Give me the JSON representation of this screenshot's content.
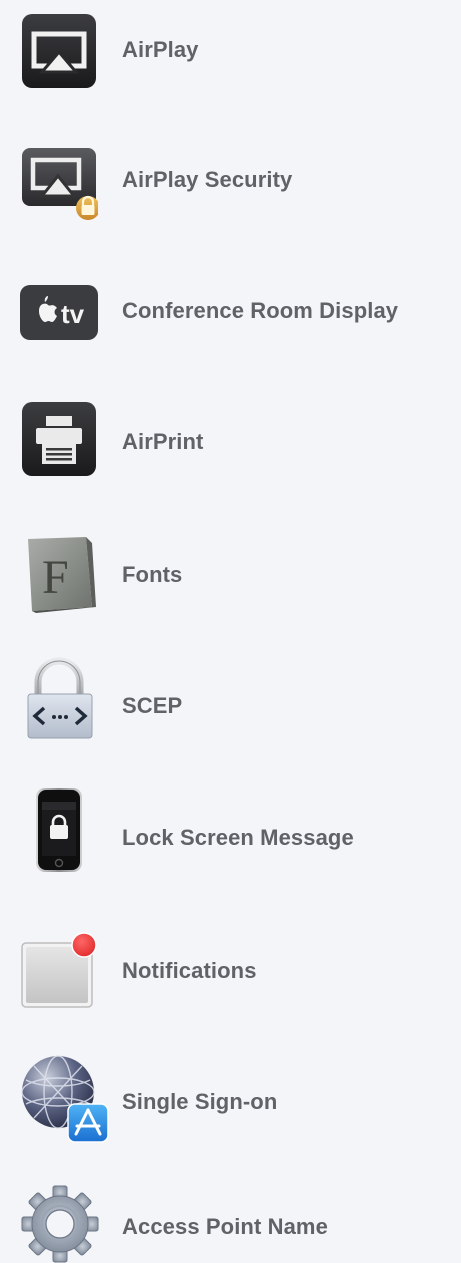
{
  "settings_list": {
    "items": [
      {
        "label": "AirPlay",
        "icon": "airplay-icon"
      },
      {
        "label": "AirPlay Security",
        "icon": "airplay-security-icon"
      },
      {
        "label": "Conference Room Display",
        "icon": "apple-tv-icon"
      },
      {
        "label": "AirPrint",
        "icon": "printer-icon"
      },
      {
        "label": "Fonts",
        "icon": "font-book-icon"
      },
      {
        "label": "SCEP",
        "icon": "padlock-code-icon"
      },
      {
        "label": "Lock Screen Message",
        "icon": "iphone-lock-icon"
      },
      {
        "label": "Notifications",
        "icon": "notification-badge-icon"
      },
      {
        "label": "Single Sign-on",
        "icon": "globe-app-store-icon"
      },
      {
        "label": "Access Point Name",
        "icon": "gear-icon"
      }
    ]
  },
  "colors": {
    "background": "#f4f5f9",
    "label_text": "#616267",
    "badge_red": "#f23b3b",
    "lock_gold": "#d69a35"
  }
}
